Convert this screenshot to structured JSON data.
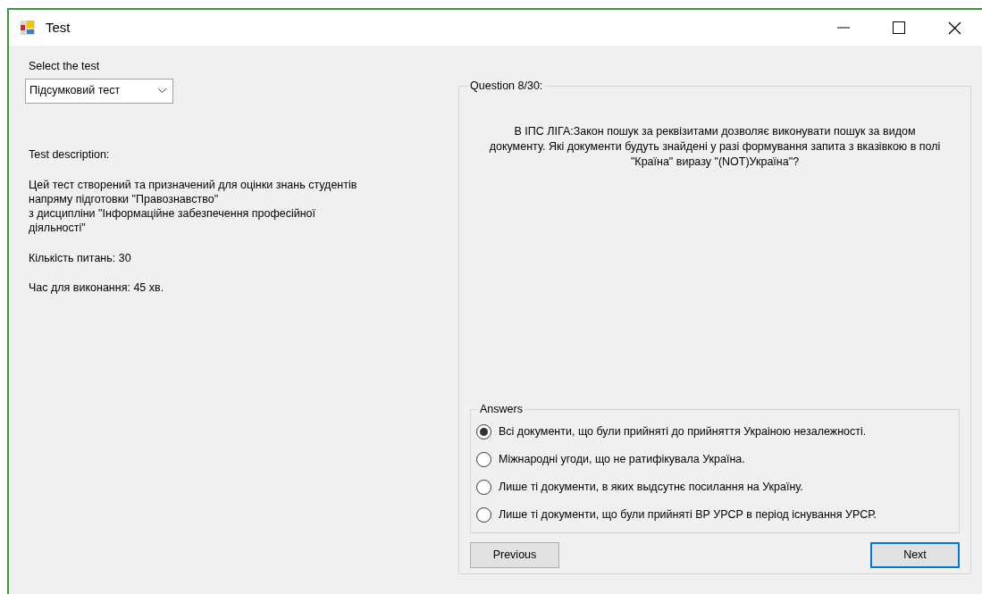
{
  "window": {
    "title": "Test"
  },
  "test_selector": {
    "label": "Select the test",
    "value": "Підсумковий тест"
  },
  "description": {
    "heading": "Test description:",
    "text": "Цей тест створений та призначений для оцінки знань студентів напряму підготовки \"Правознавство\"\nз дисципліни \"Інформаційне забезпечення професійної діяльності\"",
    "question_count": "Кількість питань: 30",
    "time_limit": "Час для виконання: 45 хв."
  },
  "question": {
    "label": "Question 8/30:",
    "text": "В ІПС ЛІГА:Закон пошук за реквізитами дозволяє виконувати пошук за видом документу. Які документи будуть знайдені у разі формування запита з вказівкою в полі \"Країна\" виразу \"(NOT)Україна\"?"
  },
  "answers": {
    "label": "Answers",
    "options": [
      {
        "text": "Всі документи, що були прийняті до прийняття Украіною незалежності.",
        "selected": true
      },
      {
        "text": "Міжнародні угоди, що не ратифікувала Україна.",
        "selected": false
      },
      {
        "text": "Лише ті документи, в яких выдсутнє посилання на Україну.",
        "selected": false
      },
      {
        "text": "Лише ті документи, що були прийняті ВР УРСР в період існування УРСР.",
        "selected": false
      }
    ]
  },
  "buttons": [
    {
      "label": "Previous",
      "focused": false
    },
    {
      "label": "Next",
      "focused": true
    }
  ]
}
